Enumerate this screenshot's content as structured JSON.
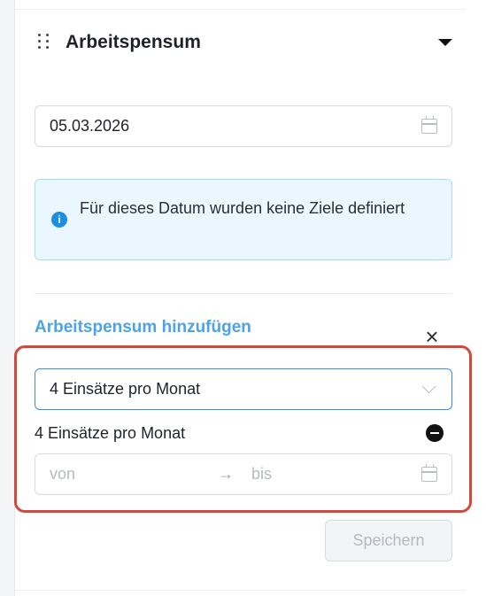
{
  "widget": {
    "title": "Arbeitspensum",
    "collapse_icon": "caret-down-icon",
    "drag_icon": "drag-handle-icon"
  },
  "date_filter": {
    "value": "05.03.2026",
    "icon": "calendar-icon"
  },
  "info_alert": {
    "icon": "info-icon",
    "icon_glyph": "i",
    "text": "Für dieses Datum wurden keine Ziele definiert"
  },
  "add_form": {
    "title": "Arbeitspensum hinzufügen",
    "close_label": "×",
    "select": {
      "value": "4 Einsätze pro Monat",
      "icon": "chevron-down-icon"
    },
    "selected_item": {
      "label": "4 Einsätze pro Monat",
      "remove_icon": "minus-circle-icon"
    },
    "range": {
      "from_placeholder": "von",
      "separator": "→",
      "to_placeholder": "bis",
      "icon": "calendar-icon"
    },
    "save_label": "Speichern"
  },
  "colors": {
    "accent": "#4ea3e6",
    "info_bg": "#eaf7ff",
    "info_border": "#a7dcf7",
    "info_icon": "#1d8fe0",
    "highlight": "#d2483a"
  }
}
